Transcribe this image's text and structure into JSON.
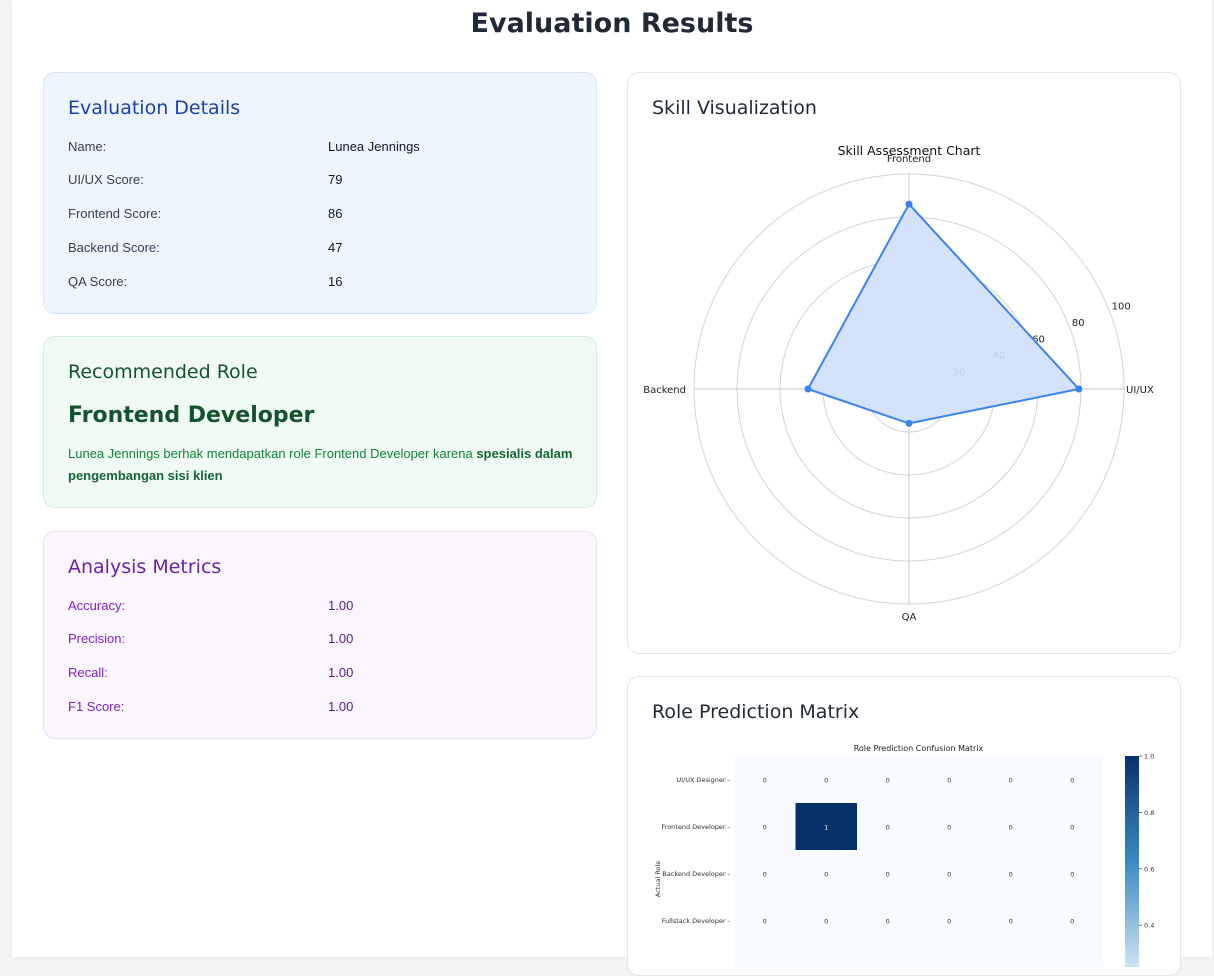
{
  "page": {
    "title": "Evaluation Results"
  },
  "details": {
    "title": "Evaluation Details",
    "rows": [
      {
        "label": "Name:",
        "value": "Lunea Jennings"
      },
      {
        "label": "UI/UX Score:",
        "value": "79"
      },
      {
        "label": "Frontend Score:",
        "value": "86"
      },
      {
        "label": "Backend Score:",
        "value": "47"
      },
      {
        "label": "QA Score:",
        "value": "16"
      }
    ]
  },
  "role": {
    "title": "Recommended Role",
    "name": "Frontend Developer",
    "description": "Lunea Jennings berhak mendapatkan role Frontend Developer karena ",
    "reason": "spesialis dalam pengembangan sisi klien"
  },
  "metrics": {
    "title": "Analysis Metrics",
    "rows": [
      {
        "label": "Accuracy:",
        "value": "1.00"
      },
      {
        "label": "Precision:",
        "value": "1.00"
      },
      {
        "label": "Recall:",
        "value": "1.00"
      },
      {
        "label": "F1 Score:",
        "value": "1.00"
      }
    ]
  },
  "visualization": {
    "title": "Skill Visualization"
  },
  "matrix_section": {
    "title": "Role Prediction Matrix"
  },
  "chart_data": [
    {
      "type": "radar",
      "title": "Skill Assessment Chart",
      "categories": [
        "UI/UX",
        "Frontend",
        "Backend",
        "QA"
      ],
      "values": [
        79,
        86,
        47,
        16
      ],
      "rlim": [
        0,
        100
      ],
      "r_ticks": [
        "20",
        "40",
        "60",
        "80",
        "100"
      ],
      "grid": true,
      "line_color": "#3b82f6",
      "fill_color": "#cfe0fb"
    },
    {
      "type": "heatmap",
      "title": "Role Prediction Confusion Matrix",
      "ylabel": "Actual Role",
      "row_labels": [
        "UI/UX Designer",
        "Frontend Developer",
        "Backend Developer",
        "Fullstack Developer"
      ],
      "values": [
        [
          0,
          0,
          0,
          0,
          0,
          0
        ],
        [
          0,
          1,
          0,
          0,
          0,
          0
        ],
        [
          0,
          0,
          0,
          0,
          0,
          0
        ],
        [
          0,
          0,
          0,
          0,
          0,
          0
        ]
      ],
      "cell_labels": [
        [
          "0",
          "0",
          "0",
          "0",
          "0",
          "0"
        ],
        [
          "0",
          "1",
          "0",
          "0",
          "0",
          "0"
        ],
        [
          "0",
          "0",
          "0",
          "0",
          "0",
          "0"
        ],
        [
          "0",
          "0",
          "0",
          "0",
          "0",
          "0"
        ]
      ],
      "colorbar_ticks": [
        "1.0",
        "0.8",
        "0.6",
        "0.4"
      ],
      "colorbar_range": [
        0,
        1
      ],
      "cmap": "Blues",
      "high_color": "#08306b",
      "low_color": "#f7fbff"
    }
  ]
}
